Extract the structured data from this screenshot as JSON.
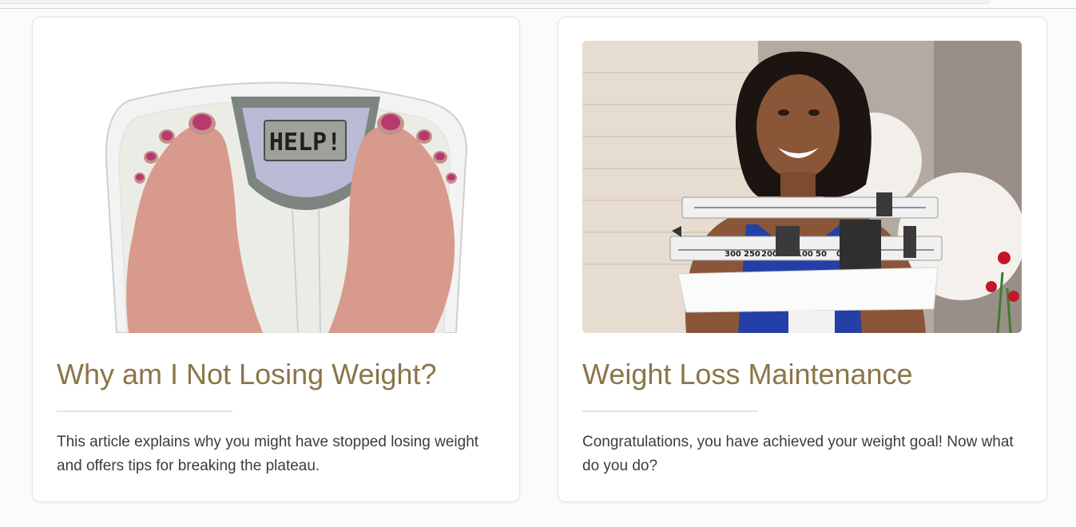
{
  "colors": {
    "title": "#8c7548",
    "body_text": "#3c3c3c",
    "card_background": "#ffffff",
    "page_background": "#fbfbfb"
  },
  "cards": [
    {
      "image_icon": "bathroom-scale-feet-photo",
      "scale_display": "HELP!",
      "title": "Why am I Not Losing Weight?",
      "description": "This article explains why you might have stopped losing weight and offers tips for breaking the plateau."
    },
    {
      "image_icon": "woman-with-balance-scale-photo",
      "scale_numbers": [
        "300",
        "250",
        "200",
        "100",
        "50",
        "0"
      ],
      "title": "Weight Loss Maintenance",
      "description": "Congratulations, you have achieved your weight goal! Now what do you do?"
    }
  ]
}
